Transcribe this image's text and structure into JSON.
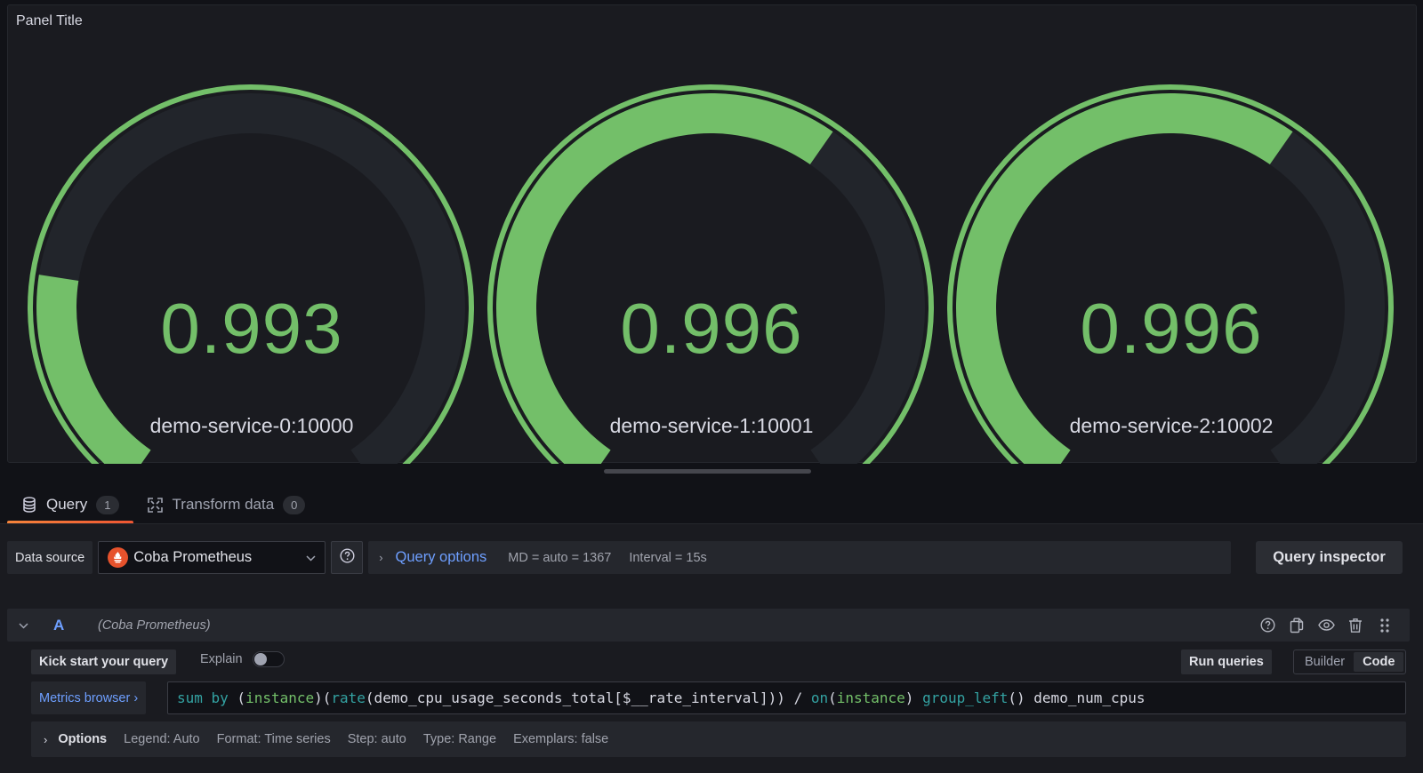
{
  "panel": {
    "title": "Panel Title"
  },
  "chart_data": {
    "type": "gauge",
    "title": "Panel Title",
    "threshold_color": "#73bf69",
    "track_color": "#22252b",
    "series": [
      {
        "name": "demo-service-0:10000",
        "value": 0.993,
        "display": "0.993",
        "fill_fraction": 0.22
      },
      {
        "name": "demo-service-1:10001",
        "value": 0.996,
        "display": "0.996",
        "fill_fraction": 0.62
      },
      {
        "name": "demo-service-2:10002",
        "value": 0.996,
        "display": "0.996",
        "fill_fraction": 0.62
      }
    ]
  },
  "tabs": [
    {
      "label": "Query",
      "count": "1",
      "icon": "database-icon",
      "active": true
    },
    {
      "label": "Transform data",
      "count": "0",
      "icon": "transform-icon",
      "active": false
    }
  ],
  "datasource": {
    "label": "Data source",
    "selected": "Coba Prometheus",
    "icon": "prometheus-icon",
    "help_icon": "question-circle-icon"
  },
  "query_options": {
    "title": "Query options",
    "md": "MD = auto = 1367",
    "interval": "Interval = 15s"
  },
  "query_inspector_label": "Query inspector",
  "query": {
    "ref_id": "A",
    "datasource": "(Coba Prometheus)",
    "actions": [
      "question-circle-icon",
      "copy-icon",
      "eye-icon",
      "trash-icon",
      "drag-handle-icon"
    ],
    "kick_start_label": "Kick start your query",
    "explain_label": "Explain",
    "explain_enabled": false,
    "run_label": "Run queries",
    "modes": [
      "Builder",
      "Code"
    ],
    "active_mode": "Code",
    "metrics_browser_label": "Metrics browser ›",
    "expression_tokens": [
      {
        "t": "sum by",
        "c": "kw"
      },
      {
        "t": " (",
        "c": "plain"
      },
      {
        "t": "instance",
        "c": "lbl"
      },
      {
        "t": ")(",
        "c": "plain"
      },
      {
        "t": "rate",
        "c": "fn"
      },
      {
        "t": "(demo_cpu_usage_seconds_total[$__rate_interval])) / ",
        "c": "plain"
      },
      {
        "t": "on",
        "c": "fn"
      },
      {
        "t": "(",
        "c": "plain"
      },
      {
        "t": "instance",
        "c": "lbl"
      },
      {
        "t": ") ",
        "c": "plain"
      },
      {
        "t": "group_left",
        "c": "fn"
      },
      {
        "t": "() demo_num_cpus",
        "c": "plain"
      }
    ],
    "options": {
      "title": "Options",
      "items": [
        "Legend: Auto",
        "Format: Time series",
        "Step: auto",
        "Type: Range",
        "Exemplars: false"
      ]
    }
  }
}
